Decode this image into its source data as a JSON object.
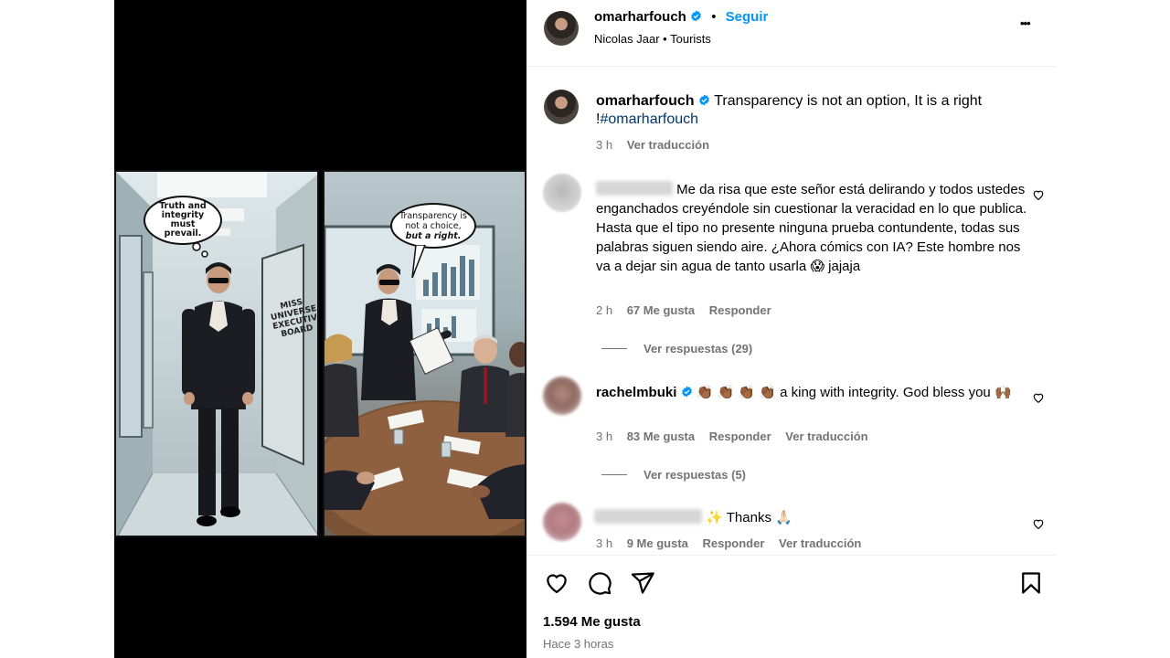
{
  "post": {
    "author": "omarharfouch",
    "follow_label": "Seguir",
    "dot": "•",
    "audio_artist": "Nicolas Jaar",
    "audio_sep": "•",
    "audio_track": "Tourists",
    "more_label": "•••"
  },
  "caption": {
    "author": "omarharfouch",
    "text": "Transparency is not an option, It is a right",
    "text2_prefix": "!",
    "hashtag": "#omarharfouch",
    "time": "3 h",
    "translate": "Ver traducción"
  },
  "comic": {
    "bubble_left": "Truth and integrity must prevail.",
    "sign": "MISS UNIVERSE EXECUTIVE BOARD",
    "bubble_right_1": "Transparency is not a choice,",
    "bubble_right_2": "but a right."
  },
  "comments": [
    {
      "text": "Me da risa que este señor está delirando y todos ustedes enganchados creyéndole sin cuestionar la veracidad en lo que publica. Hasta que el tipo no presente ninguna prueba contundente, todas sus palabras siguen siendo aire. ¿Ahora cómics con IA? Este hombre nos va a dejar sin agua de tanto usarla",
      "emoji": "😱",
      "tail": "jajaja",
      "time": "2 h",
      "likes": "67 Me gusta",
      "reply": "Responder",
      "view_replies": "Ver respuestas (29)"
    },
    {
      "author": "rachelmbuki",
      "emojis": "👏🏾 👏🏾 👏🏾 👏🏾",
      "text": "a king with integrity. God bless you",
      "emoji_end": "🙌🏾",
      "time": "3 h",
      "likes": "83 Me gusta",
      "reply": "Responder",
      "translate": "Ver traducción",
      "view_replies": "Ver respuestas (5)"
    },
    {
      "emoji_start": "✨",
      "text": "Thanks",
      "emoji_end": "🙏🏻",
      "time": "3 h",
      "likes": "9 Me gusta",
      "reply": "Responder",
      "translate": "Ver traducción"
    }
  ],
  "footer": {
    "likes": "1.594 Me gusta",
    "time_ago": "Hace 3 horas"
  },
  "icons": [
    "verified-badge-icon",
    "more-options-icon",
    "heart-icon",
    "comment-icon",
    "share-icon",
    "bookmark-icon"
  ],
  "colors": {
    "link": "#0095f6",
    "verified": "#0095f6",
    "meta": "#737373",
    "divider": "#efefef"
  }
}
